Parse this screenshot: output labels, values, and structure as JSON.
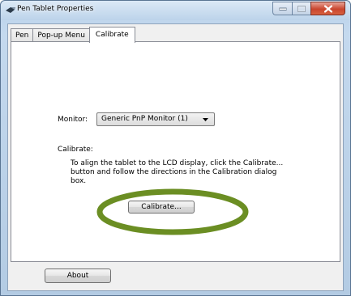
{
  "window": {
    "title": "Pen Tablet Properties",
    "icons": [
      "pen-icon",
      "minimize-icon",
      "maximize-icon",
      "close-icon"
    ]
  },
  "tabs": [
    {
      "label": "Pen",
      "active": false
    },
    {
      "label": "Pop-up Menu",
      "active": false
    },
    {
      "label": "Calibrate",
      "active": true
    }
  ],
  "calibrate_tab": {
    "monitor_label": "Monitor:",
    "monitor_selected": "Generic PnP Monitor (1)",
    "calibrate_heading": "Calibrate:",
    "instructions": "To align the tablet to the LCD display, click the Calibrate... button and follow the directions in the Calibration dialog box.",
    "calibrate_button": "Calibrate..."
  },
  "footer": {
    "about_button": "About"
  },
  "colors": {
    "highlight_ellipse": "#6b8e23",
    "close_button": "#c9452e",
    "titlebar": "#bcd3ea"
  }
}
